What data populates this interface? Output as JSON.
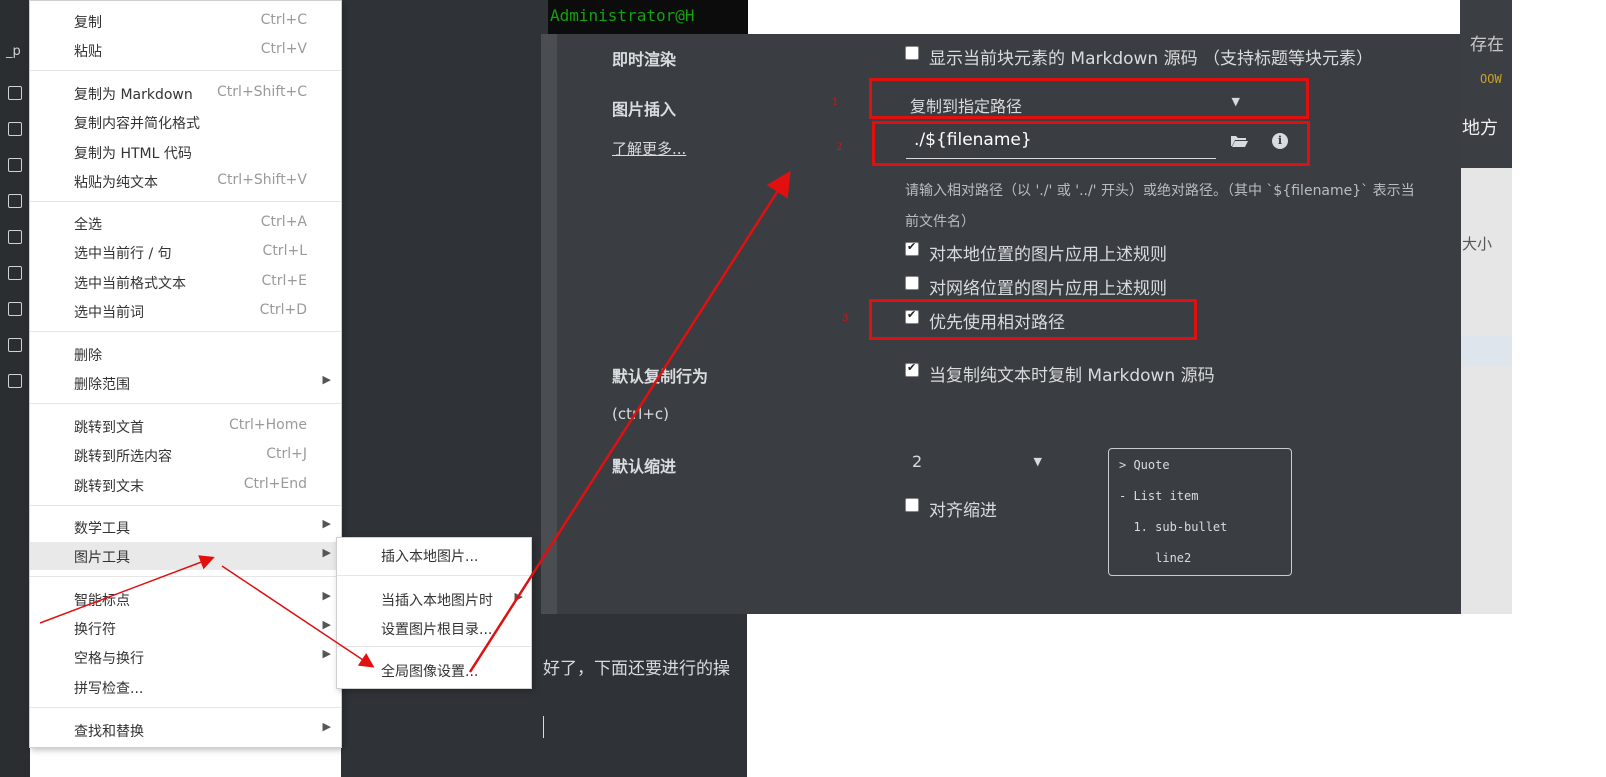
{
  "terminal": {
    "text": "Administrator@H"
  },
  "editor": {
    "text_fragment": "好了，下面还要进行的操"
  },
  "background_right": {
    "text1": "地方",
    "text2": "大小",
    "top_fragment": "存在",
    "green_fragment": "OOW"
  },
  "left_strip": {
    "frag": "_p"
  },
  "context_menu": {
    "items": [
      {
        "label": "复制",
        "shortcut": "Ctrl+C"
      },
      {
        "label": "粘贴",
        "shortcut": "Ctrl+V"
      },
      {
        "label": "复制为 Markdown",
        "shortcut": "Ctrl+Shift+C"
      },
      {
        "label": "复制内容并简化格式",
        "shortcut": ""
      },
      {
        "label": "复制为 HTML 代码",
        "shortcut": ""
      },
      {
        "label": "粘贴为纯文本",
        "shortcut": "Ctrl+Shift+V"
      },
      {
        "label": "全选",
        "shortcut": "Ctrl+A"
      },
      {
        "label": "选中当前行 / 句",
        "shortcut": "Ctrl+L"
      },
      {
        "label": "选中当前格式文本",
        "shortcut": "Ctrl+E"
      },
      {
        "label": "选中当前词",
        "shortcut": "Ctrl+D"
      },
      {
        "label": "删除",
        "shortcut": ""
      },
      {
        "label": "删除范围",
        "shortcut": ""
      },
      {
        "label": "跳转到文首",
        "shortcut": "Ctrl+Home"
      },
      {
        "label": "跳转到所选内容",
        "shortcut": "Ctrl+J"
      },
      {
        "label": "跳转到文末",
        "shortcut": "Ctrl+End"
      },
      {
        "label": "数学工具",
        "shortcut": ""
      },
      {
        "label": "图片工具",
        "shortcut": ""
      },
      {
        "label": "智能标点",
        "shortcut": ""
      },
      {
        "label": "换行符",
        "shortcut": ""
      },
      {
        "label": "空格与换行",
        "shortcut": ""
      },
      {
        "label": "拼写检查...",
        "shortcut": ""
      },
      {
        "label": "查找和替换",
        "shortcut": ""
      }
    ]
  },
  "image_submenu": {
    "items": [
      {
        "label": "插入本地图片..."
      },
      {
        "label": "当插入本地图片时"
      },
      {
        "label": "设置图片根目录..."
      },
      {
        "label": "全局图像设置..."
      }
    ]
  },
  "preferences": {
    "instant_render_label": "即时渲染",
    "instant_render_option": "显示当前块元素的 Markdown 源码 （支持标题等块元素）",
    "image_insert_label": "图片插入",
    "learn_more": "了解更多...",
    "image_insert_mode": "复制到指定路径",
    "image_path": "./${filename}",
    "path_hint_line1": "请输入相对路径（以 './' 或 '../' 开头）或绝对路径。（其中 `${filename}` 表示当",
    "path_hint_line2": "前文件名）",
    "apply_local": {
      "label": "对本地位置的图片应用上述规则",
      "checked": true
    },
    "apply_network": {
      "label": "对网络位置的图片应用上述规则",
      "checked": false
    },
    "prefer_relative": {
      "label": "优先使用相对路径",
      "checked": true
    },
    "default_copy_label": "默认复制行为",
    "default_copy_sub": "(ctrl+c)",
    "default_copy_option": {
      "label": "当复制纯文本时复制 Markdown 源码",
      "checked": true
    },
    "default_indent_label": "默认缩进",
    "default_indent_value": "2",
    "align_indent": {
      "label": "对齐缩进",
      "checked": false
    },
    "preview_lines": [
      "> Quote",
      "- List item",
      "  1. sub-bullet",
      "     line2"
    ]
  },
  "annotations": {
    "n1": "1",
    "n2": "2",
    "n3": "3"
  },
  "colors": {
    "annotation_red": "#e01010",
    "panel_bg": "#3a3d41"
  }
}
